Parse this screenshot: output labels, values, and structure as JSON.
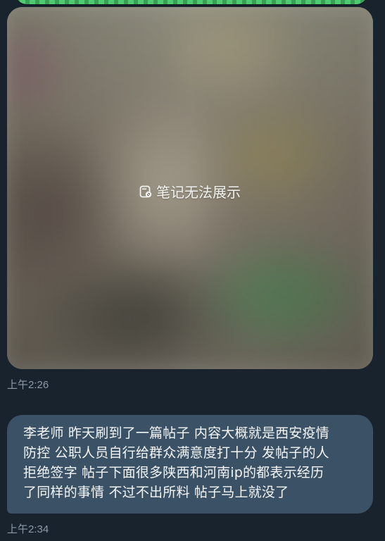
{
  "messages": [
    {
      "type": "note",
      "label": "笔记无法展示",
      "icon": "note-icon",
      "time": "上午2:26"
    },
    {
      "type": "text",
      "lines": [
        "李老师 昨天刷到了一篇帖子 内容大概就是西安疫情",
        "防控 公职人员自行给群众满意度打十分 发帖子的人",
        "拒绝签字 帖子下面很多陕西和河南ip的都表示经历",
        "了同样的事情 不过不出所料 帖子马上就没了"
      ],
      "time": "上午2:34"
    }
  ],
  "colors": {
    "background": "#18232e",
    "bubble": "#3b5266",
    "timestamp": "#8d99a6",
    "previous_bubble_accent": "#49c96b"
  }
}
